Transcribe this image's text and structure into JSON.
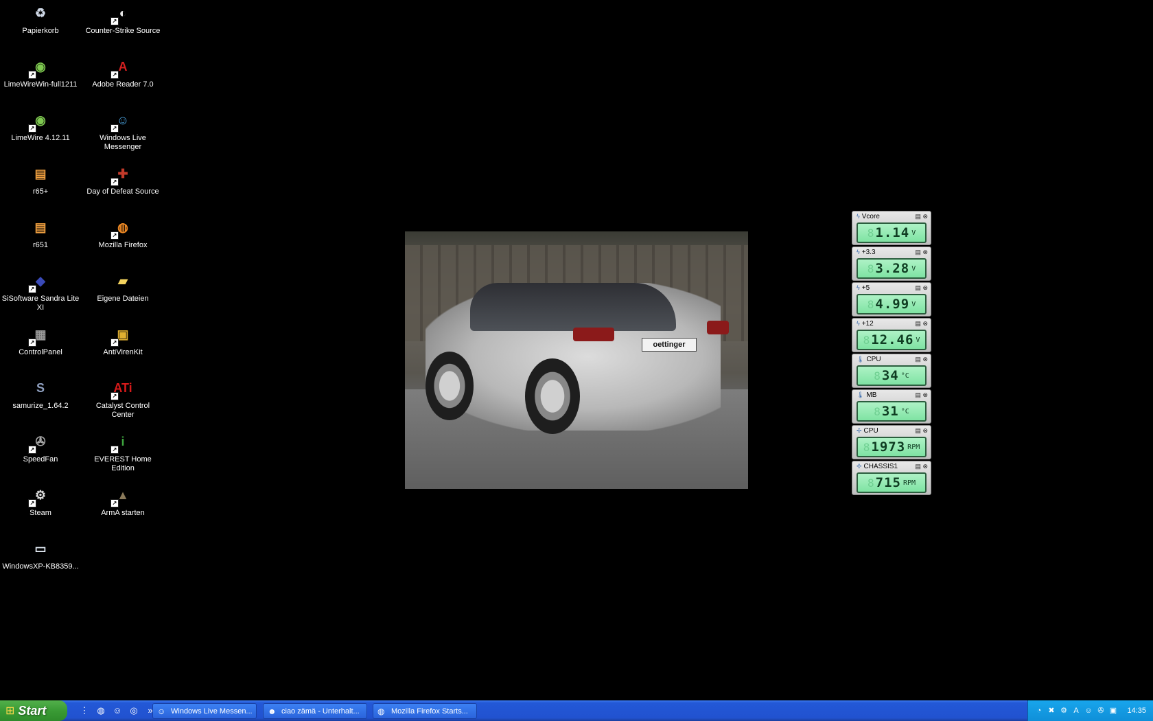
{
  "desktop": {
    "icons": [
      {
        "label": "Papierkorb",
        "icon": "recycle-bin-icon",
        "glyph": "♻",
        "color": "#cfd8e6"
      },
      {
        "label": "Counter-Strike Source",
        "icon": "counter-strike-icon",
        "glyph": "◐",
        "color": "#e8e8e8"
      },
      {
        "label": "LimeWireWin-full1211",
        "icon": "limewire-icon",
        "glyph": "◉",
        "color": "#7ec850"
      },
      {
        "label": "Adobe Reader 7.0",
        "icon": "adobe-reader-icon",
        "glyph": "A",
        "color": "#d62020"
      },
      {
        "label": "LimeWire 4.12.11",
        "icon": "limewire-icon",
        "glyph": "◉",
        "color": "#7ec850"
      },
      {
        "label": "Windows Live Messenger",
        "icon": "messenger-icon",
        "glyph": "☺",
        "color": "#4aa3df"
      },
      {
        "label": "r65+",
        "icon": "file-icon",
        "glyph": "▤",
        "color": "#f0a040"
      },
      {
        "label": "Day of Defeat Source",
        "icon": "day-of-defeat-icon",
        "glyph": "✚",
        "color": "#c23a2a"
      },
      {
        "label": "r651",
        "icon": "file-icon",
        "glyph": "▤",
        "color": "#f0a040"
      },
      {
        "label": "Mozilla Firefox",
        "icon": "firefox-icon",
        "glyph": "◍",
        "color": "#f08a24"
      },
      {
        "label": "SiSoftware Sandra Lite XI",
        "icon": "sandra-icon",
        "glyph": "◆",
        "color": "#3a4ab8"
      },
      {
        "label": "Eigene Dateien",
        "icon": "folder-icon",
        "glyph": "▰",
        "color": "#f4d35e"
      },
      {
        "label": "ControlPanel",
        "icon": "control-panel-icon",
        "glyph": "▦",
        "color": "#9a9a9a"
      },
      {
        "label": "AntiVirenKit",
        "icon": "antivirus-icon",
        "glyph": "▣",
        "color": "#e0b030"
      },
      {
        "label": "samurize_1.64.2",
        "icon": "samurize-icon",
        "glyph": "S",
        "color": "#8fa0c0"
      },
      {
        "label": "Catalyst Control Center",
        "icon": "ati-icon",
        "glyph": "ATi",
        "color": "#d61a1a"
      },
      {
        "label": "SpeedFan",
        "icon": "speedfan-icon",
        "glyph": "✇",
        "color": "#aaaaaa"
      },
      {
        "label": "EVEREST Home Edition",
        "icon": "everest-icon",
        "glyph": "i",
        "color": "#3ea63e"
      },
      {
        "label": "Steam",
        "icon": "steam-icon",
        "glyph": "⚙",
        "color": "#dddddd"
      },
      {
        "label": "ArmA starten",
        "icon": "arma-icon",
        "glyph": "▲",
        "color": "#8a7a5a"
      },
      {
        "label": "WindowsXP-KB8359...",
        "icon": "installer-window-icon",
        "glyph": "▭",
        "color": "#e6eef8"
      }
    ]
  },
  "wallpaper": {
    "plate_text": "oettinger"
  },
  "gadgets": [
    {
      "label": "Vcore",
      "icon": "voltage-icon",
      "glyph": "ϟ",
      "value": "1.14",
      "unit": "V"
    },
    {
      "label": "+3.3",
      "icon": "voltage-icon",
      "glyph": "ϟ",
      "value": "3.28",
      "unit": "V"
    },
    {
      "label": "+5",
      "icon": "voltage-icon",
      "glyph": "ϟ",
      "value": "4.99",
      "unit": "V"
    },
    {
      "label": "+12",
      "icon": "voltage-icon",
      "glyph": "ϟ",
      "value": "12.46",
      "unit": "V"
    },
    {
      "label": "CPU",
      "icon": "thermometer-icon",
      "glyph": "🌡",
      "value": "34",
      "unit": "°C"
    },
    {
      "label": "MB",
      "icon": "thermometer-icon",
      "glyph": "🌡",
      "value": "31",
      "unit": "°C"
    },
    {
      "label": "CPU",
      "icon": "fan-icon",
      "glyph": "✢",
      "value": "1973",
      "unit": "RPM"
    },
    {
      "label": "CHASSIS1",
      "icon": "fan-icon",
      "glyph": "✢",
      "value": "715",
      "unit": "RPM"
    }
  ],
  "taskbar": {
    "start_label": "Start",
    "quick_launch": [
      {
        "icon": "firefox-icon",
        "glyph": "◍"
      },
      {
        "icon": "messenger-icon",
        "glyph": "☺"
      },
      {
        "icon": "media-player-icon",
        "glyph": "◎"
      }
    ],
    "tasks": [
      {
        "label": "Windows Live Messen...",
        "icon": "messenger-icon",
        "glyph": "☺"
      },
      {
        "label": "ciao zämä - Unterhalt...",
        "icon": "chat-icon",
        "glyph": "☻"
      },
      {
        "label": "Mozilla Firefox Starts...",
        "icon": "firefox-icon",
        "glyph": "◍"
      }
    ],
    "tray_icons": [
      {
        "icon": "network-icon",
        "glyph": "◔"
      },
      {
        "icon": "antivirus-tray-icon",
        "glyph": "✖"
      },
      {
        "icon": "steam-tray-icon",
        "glyph": "⚙"
      },
      {
        "icon": "ati-tray-icon",
        "glyph": "A"
      },
      {
        "icon": "messenger-tray-icon",
        "glyph": "☺"
      },
      {
        "icon": "speedfan-tray-icon",
        "glyph": "✇"
      },
      {
        "icon": "display-tray-icon",
        "glyph": "▣"
      }
    ],
    "clock": "14:35"
  },
  "colors": {
    "desktop_bg": "#000000",
    "taskbar_blue": "#2152d0",
    "start_green": "#3a9b35",
    "lcd_green": "#8fe8b0"
  }
}
